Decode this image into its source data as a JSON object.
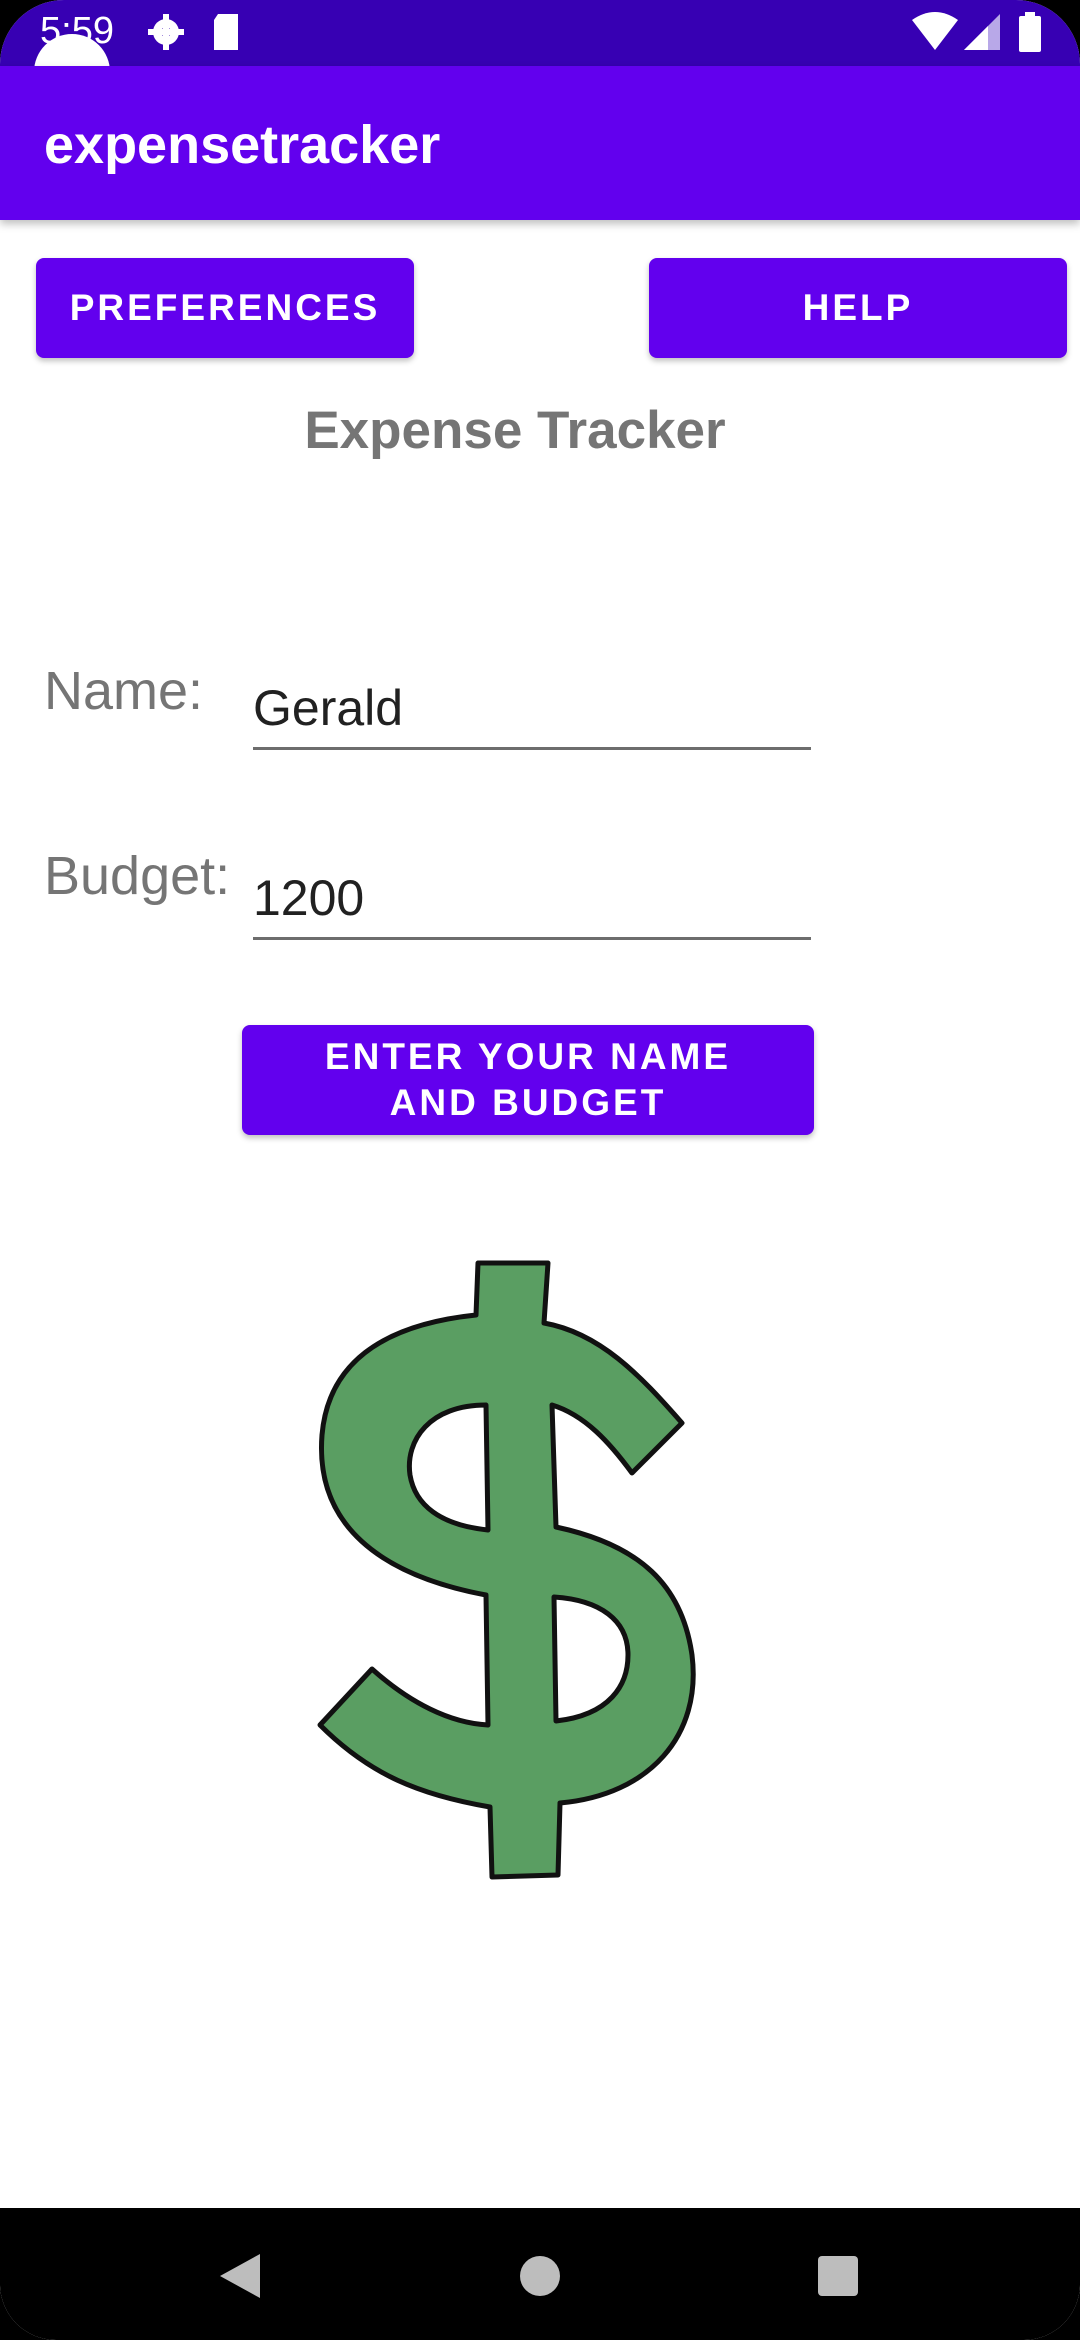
{
  "status_bar": {
    "time": "5:59",
    "icons": [
      "gear-icon",
      "sd-card-icon",
      "wifi-icon",
      "signal-icon",
      "battery-icon"
    ]
  },
  "app_bar": {
    "title": "expensetracker"
  },
  "toolbar": {
    "preferences_label": "PREFERENCES",
    "help_label": "HELP"
  },
  "main": {
    "title": "Expense Tracker",
    "name_label": "Name:",
    "name_value": "Gerald",
    "budget_label": "Budget:",
    "budget_value": "1200",
    "submit_label": "ENTER YOUR NAME AND BUDGET",
    "image": "dollar-sign-icon"
  },
  "nav_bar": {
    "icons": [
      "back-icon",
      "home-icon",
      "recents-icon"
    ]
  },
  "colors": {
    "primary": "#6200ee",
    "primary_dark": "#3700b3",
    "dollar_green": "#5a9e62"
  }
}
